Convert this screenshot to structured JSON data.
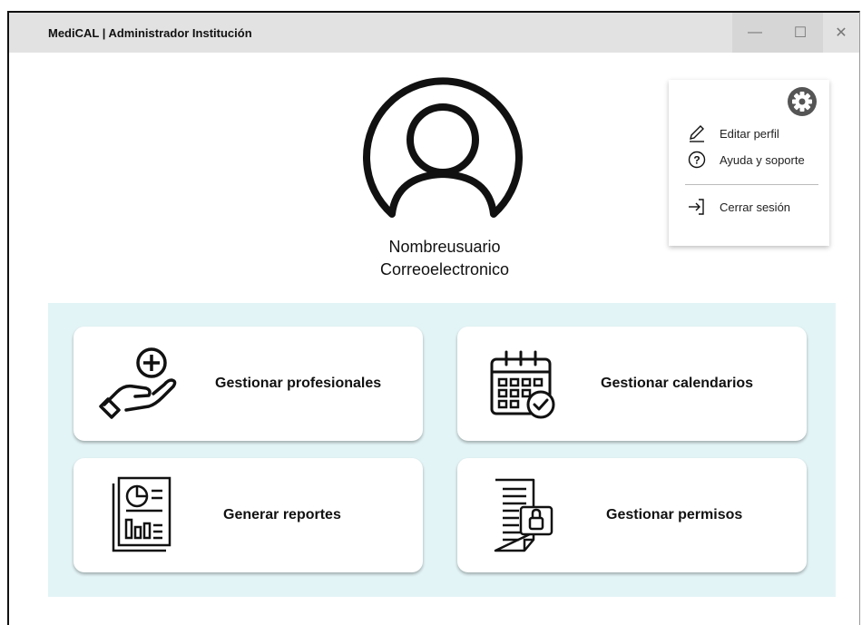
{
  "window": {
    "title": "MediCAL | Administrador Institución",
    "controls": {
      "minimize": "—",
      "maximize": "☐",
      "close": "✕"
    }
  },
  "profile": {
    "username": "Nombreusuario",
    "email": "Correoelectronico",
    "avatar_icon": "user-circle-icon"
  },
  "menu": {
    "settings_icon": "gear-icon",
    "items": [
      {
        "label": "Editar perfil",
        "icon": "pencil-icon"
      },
      {
        "label": "Ayuda y soporte",
        "icon": "help-circle-icon"
      },
      {
        "label": "Cerrar sesión",
        "icon": "logout-icon"
      }
    ]
  },
  "tiles": [
    {
      "label": "Gestionar profesionales",
      "icon": "hand-plus-icon"
    },
    {
      "label": "Gestionar calendarios",
      "icon": "calendar-check-icon"
    },
    {
      "label": "Generar reportes",
      "icon": "report-chart-icon"
    },
    {
      "label": "Gestionar permisos",
      "icon": "document-lock-icon"
    }
  ],
  "colors": {
    "titlebar": "#e2e2e2",
    "tiles_background": "#e3f4f6",
    "tile": "#ffffff",
    "gear": "#555555"
  }
}
